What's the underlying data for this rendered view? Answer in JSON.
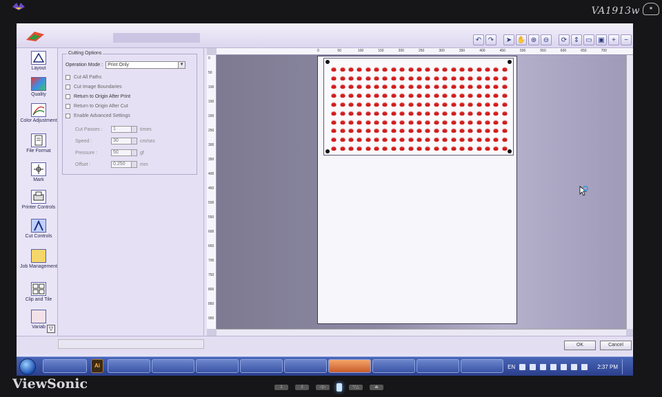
{
  "monitor": {
    "model": "VA1913w",
    "brand": "ViewSonic",
    "buttons": [
      "1",
      "2",
      "◁▷",
      "",
      "▽△",
      "⏏"
    ]
  },
  "window": {
    "title": ""
  },
  "toolbar": {
    "icons": [
      "undo-icon",
      "redo-icon",
      "pointer-icon",
      "hand-icon",
      "zoom-in-icon",
      "zoom-out-icon",
      "rotate-icon",
      "fit-icon",
      "page-icon",
      "view-icon",
      "plus-icon",
      "minus-icon"
    ]
  },
  "sidebar": {
    "items": [
      {
        "label": "Layout",
        "icon": "layout-icon"
      },
      {
        "label": "Quality",
        "icon": "quality-icon"
      },
      {
        "label": "Color Adjustment",
        "icon": "color-adjustment-icon"
      },
      {
        "label": "File Format",
        "icon": "file-format-icon"
      },
      {
        "label": "Mark",
        "icon": "mark-icon"
      },
      {
        "label": "Printer Controls",
        "icon": "printer-icon"
      },
      {
        "label": "Cut Controls",
        "icon": "cut-icon"
      },
      {
        "label": "Job Management",
        "icon": "job-management-icon"
      },
      {
        "label": "Clip and Tile",
        "icon": "clip-tile-icon"
      },
      {
        "label": "Variab",
        "icon": "variable-data-icon"
      }
    ],
    "active": "Cut Controls"
  },
  "cutting_options": {
    "legend": "Cutting Options",
    "operation_mode_label": "Operation Mode :",
    "operation_mode_value": "Print Only",
    "checkboxes": [
      {
        "label": "Cut All Paths",
        "checked": false
      },
      {
        "label": "Cut Image Boundaries",
        "checked": false
      },
      {
        "label": "Return to Origin After Print",
        "checked": false
      },
      {
        "label": "Return to Origin After Cut",
        "checked": false
      },
      {
        "label": "Enable Advanced Settings",
        "checked": false
      }
    ],
    "settings": [
      {
        "label": "Cut Passes :",
        "value": "1",
        "unit": "times"
      },
      {
        "label": "Speed :",
        "value": "30",
        "unit": "cm/sec"
      },
      {
        "label": "Pressure :",
        "value": "50",
        "unit": "gf"
      },
      {
        "label": "Offset :",
        "value": "0.250",
        "unit": "mm"
      }
    ]
  },
  "rulers": {
    "top": [
      "0",
      "50",
      "100",
      "150",
      "200",
      "250",
      "300",
      "350",
      "400",
      "450",
      "500",
      "550",
      "600",
      "650",
      "700"
    ],
    "left": [
      "0",
      "50",
      "100",
      "150",
      "200",
      "250",
      "300",
      "350",
      "400",
      "450",
      "500",
      "550",
      "600",
      "650",
      "700",
      "750",
      "800",
      "850",
      "900"
    ]
  },
  "canvas": {
    "label_columns": 21,
    "label_rows": 10,
    "label_color": "#d21f1f"
  },
  "footer": {
    "ok_label": "OK",
    "cancel_label": "Cancel"
  },
  "taskbar": {
    "ai_label": "Ai",
    "language": "EN",
    "time": "2:37 PM"
  },
  "colors": {
    "window_bg": "#e7e2f4",
    "taskbar": "#2b3f8c",
    "accent": "#2b3a80"
  }
}
